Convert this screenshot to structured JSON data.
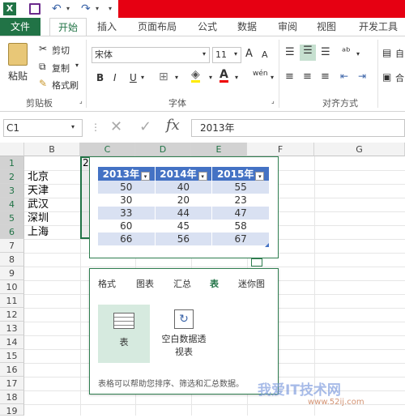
{
  "qat": {
    "excel_icon": "X"
  },
  "tabs": [
    "文件",
    "开始",
    "插入",
    "页面布局",
    "公式",
    "数据",
    "审阅",
    "视图",
    "开发工具"
  ],
  "ribbon": {
    "clipboard": {
      "paste": "粘贴",
      "cut": "剪切",
      "copy": "复制",
      "copy_arrow": "▾",
      "format_painter": "格式刷",
      "group": "剪贴板"
    },
    "font": {
      "name": "宋体",
      "size": "11",
      "grow": "A",
      "shrink": "A",
      "bold": "B",
      "italic": "I",
      "underline": "U",
      "group": "字体",
      "phonetic": "wén"
    },
    "align": {
      "group": "对齐方式"
    },
    "right": [
      "自",
      "合"
    ]
  },
  "formula_bar": {
    "name_box": "C1",
    "fx": "fx",
    "content": "2013年"
  },
  "columns": [
    "B",
    "C",
    "D",
    "E",
    "F",
    "G"
  ],
  "rows": [
    "1",
    "2",
    "3",
    "4",
    "5",
    "6",
    "7",
    "8",
    "9",
    "10",
    "11",
    "12",
    "13",
    "14",
    "15",
    "16",
    "17",
    "18",
    "19"
  ],
  "cells": {
    "b2": "北京",
    "b3": "天津",
    "b4": "武汉",
    "b5": "深圳",
    "b6": "上海",
    "c1": "2"
  },
  "quick_analysis": {
    "headers": [
      "2013年",
      "2014年",
      "2015年"
    ],
    "rows": [
      [
        "50",
        "40",
        "55"
      ],
      [
        "30",
        "20",
        "23"
      ],
      [
        "33",
        "44",
        "47"
      ],
      [
        "60",
        "45",
        "58"
      ],
      [
        "66",
        "56",
        "67"
      ]
    ]
  },
  "panel": {
    "tabs": [
      "格式",
      "图表",
      "汇总",
      "表",
      "迷你图"
    ],
    "options": [
      {
        "label": "表"
      },
      {
        "label": "空白数据透",
        "label2": "视表"
      }
    ],
    "description": "表格可以帮助您排序、筛选和汇总数据。"
  },
  "watermark": {
    "brand": "我爱IT技术网",
    "url": "www.52ij.com"
  },
  "colors": {
    "excel_green": "#217346",
    "table_blue": "#4472c4",
    "band": "#d9e1f2"
  }
}
